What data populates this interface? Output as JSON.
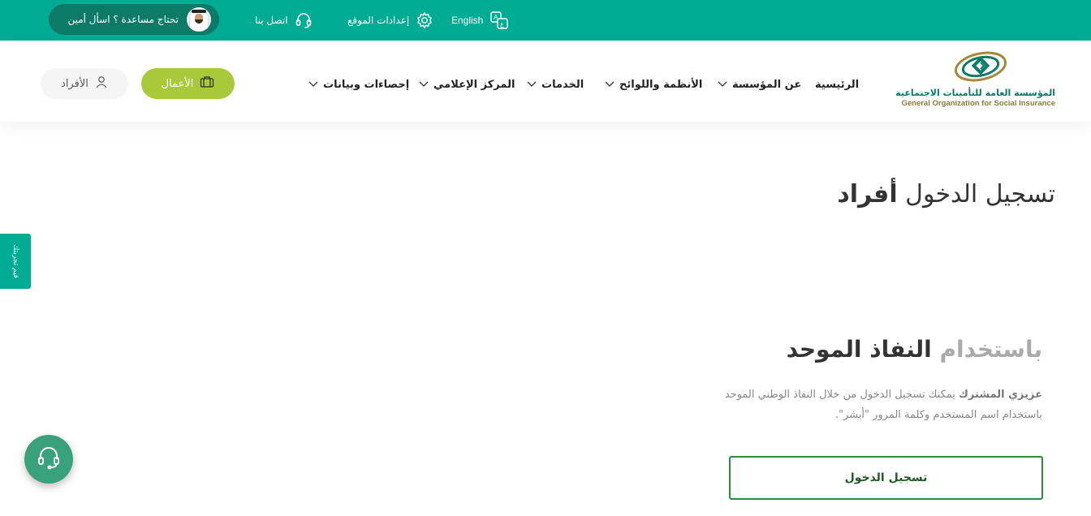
{
  "topbar": {
    "help_text": "تحتاج مساعدة ؟ اسأل أمين",
    "contact_label": "اتصل بنا",
    "settings_label": "إعدادات الموقع",
    "language_label": "English"
  },
  "header": {
    "individuals_label": "الأفراد",
    "business_label": "الأعمال",
    "nav": {
      "home": "الرئيسية",
      "about": "عن المؤسسة",
      "regulations": "الأنظمة واللوائح",
      "services": "الخدمات",
      "media": "المركز الإعلامي",
      "stats": "إحصاءات وبيانات"
    },
    "logo": {
      "ar": "المؤسسة العامة للتأمينات الاجتماعية",
      "en": "General Organization for Social Insurance"
    }
  },
  "main": {
    "title_prefix": "تسجيل الدخول ",
    "title_strong": "أفراد",
    "sso_muted": "باستخدام ",
    "sso_strong": "النفاذ الموحد",
    "desc_strong": "عزيزي المشترك",
    "desc_rest": " يمكنك تسجيل الدخول من خلال النفاذ الوطني الموحد باستخدام اسم المستخدم وكلمة المرور \"أبشر\".",
    "login_label": "تسجيل الدخول"
  },
  "side": {
    "feedback_label": "قيم تجربتك"
  },
  "colors": {
    "brand_teal": "#00ab94",
    "dark_teal": "#0b7a67",
    "lime": "#a8c93a",
    "login_border": "#2e8b3a"
  },
  "icons": {
    "contact": "headset-icon",
    "settings": "gear-icon",
    "language": "language-icon",
    "individuals": "user-icon",
    "business": "briefcase-icon",
    "chevron": "chevron-down-icon",
    "support": "headset-icon"
  }
}
